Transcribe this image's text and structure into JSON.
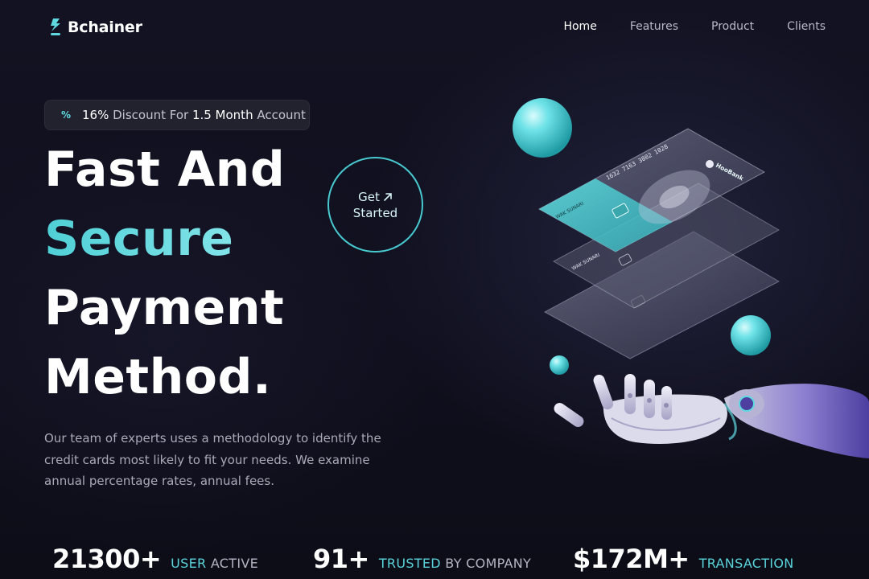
{
  "brand": {
    "name": "Bchainer"
  },
  "nav": {
    "items": [
      {
        "label": "Home",
        "active": true
      },
      {
        "label": "Features",
        "active": false
      },
      {
        "label": "Product",
        "active": false
      },
      {
        "label": "Clients",
        "active": false
      }
    ]
  },
  "discount": {
    "icon": "percent-icon",
    "percent": "16%",
    "mid": " Discount For ",
    "period": "1.5 Month",
    "suffix": " Account"
  },
  "hero": {
    "line1": "Fast And",
    "line2": "Secure",
    "line3": "Payment",
    "line4": "Method.",
    "cta_line1": "Get",
    "cta_line2": "Started",
    "description": "Our team of experts uses a methodology to identify the credit cards most likely to fit your needs. We examine annual percentage rates, annual fees."
  },
  "cards": {
    "bank_name": "HooBank",
    "card_number": "1632 7163 3802 1028",
    "holder": "WAK SUNARI"
  },
  "stats": [
    {
      "value": "21300+",
      "label_accent": "USER",
      "label_rest": " ACTIVE"
    },
    {
      "value": "91+",
      "label_accent": "TRUSTED",
      "label_rest": " BY COMPANY"
    },
    {
      "value": "$172M+",
      "label_accent": "TRANSACTION",
      "label_rest": ""
    }
  ],
  "colors": {
    "accent": "#4fd0d6",
    "background": "#0f0f1c",
    "pill_bg": "#22222f",
    "muted_text": "#a9aab8"
  }
}
